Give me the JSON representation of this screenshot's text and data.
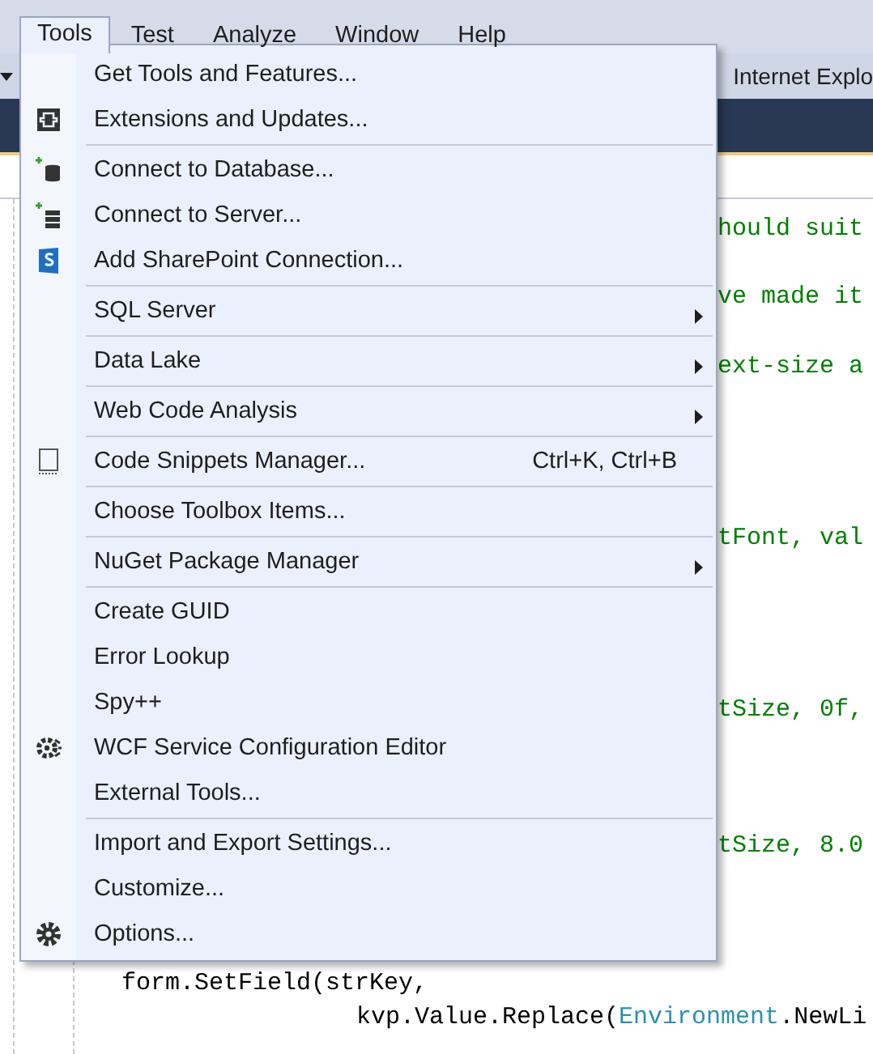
{
  "menu_bar": [
    {
      "label": "Tools",
      "selected": true
    },
    {
      "label": "Test",
      "selected": false
    },
    {
      "label": "Analyze",
      "selected": false
    },
    {
      "label": "Window",
      "selected": false
    },
    {
      "label": "Help",
      "selected": false
    }
  ],
  "toolbar": {
    "browser_button": "Internet Explo"
  },
  "editor_lines": [
    {
      "kind": "cut",
      "tokens": [
        {
          "kind": "comment",
          "text": "hould suit"
        }
      ]
    },
    {
      "kind": "blank"
    },
    {
      "kind": "cut",
      "tokens": [
        {
          "kind": "comment",
          "text": "ve made it"
        }
      ]
    },
    {
      "kind": "blank"
    },
    {
      "kind": "cut",
      "tokens": [
        {
          "kind": "comment",
          "text": "ext-size a"
        }
      ]
    },
    {
      "kind": "blank"
    },
    {
      "kind": "blank"
    },
    {
      "kind": "blank"
    },
    {
      "kind": "blank"
    },
    {
      "kind": "cut",
      "tokens": [
        {
          "kind": "comment",
          "text": "tFont, val"
        }
      ]
    },
    {
      "kind": "blank"
    },
    {
      "kind": "blank"
    },
    {
      "kind": "blank"
    },
    {
      "kind": "blank"
    },
    {
      "kind": "cut",
      "tokens": [
        {
          "kind": "comment",
          "text": "tSize, 0f,"
        }
      ]
    },
    {
      "kind": "blank"
    },
    {
      "kind": "blank"
    },
    {
      "kind": "blank"
    },
    {
      "kind": "cut",
      "tokens": [
        {
          "kind": "comment",
          "text": "tSize, 8.0"
        }
      ]
    },
    {
      "kind": "blank"
    },
    {
      "kind": "blank"
    },
    {
      "kind": "blank"
    },
    {
      "kind": "code",
      "tokens": [
        {
          "kind": "plain",
          "text": "form.SetField(strKey,"
        }
      ]
    },
    {
      "kind": "continuation",
      "tokens": [
        {
          "kind": "plain",
          "text": "kvp.Value.Replace("
        },
        {
          "kind": "type",
          "text": "Environment"
        },
        {
          "kind": "plain",
          "text": ".NewLi"
        }
      ]
    }
  ],
  "tools_menu": [
    {
      "kind": "item",
      "label": "Get Tools and Features..."
    },
    {
      "kind": "item",
      "label": "Extensions and Updates..."
    },
    {
      "kind": "separator"
    },
    {
      "kind": "item",
      "label": "Connect to Database..."
    },
    {
      "kind": "item",
      "label": "Connect to Server..."
    },
    {
      "kind": "item",
      "label": "Add SharePoint Connection..."
    },
    {
      "kind": "separator"
    },
    {
      "kind": "item",
      "label": "SQL Server",
      "submenu": true
    },
    {
      "kind": "separator"
    },
    {
      "kind": "item",
      "label": "Data Lake",
      "submenu": true
    },
    {
      "kind": "separator"
    },
    {
      "kind": "item",
      "label": "Web Code Analysis",
      "submenu": true
    },
    {
      "kind": "separator"
    },
    {
      "kind": "item",
      "label": "Code Snippets Manager...",
      "shortcut": "Ctrl+K, Ctrl+B"
    },
    {
      "kind": "separator"
    },
    {
      "kind": "item",
      "label": "Choose Toolbox Items..."
    },
    {
      "kind": "separator"
    },
    {
      "kind": "item",
      "label": "NuGet Package Manager",
      "submenu": true
    },
    {
      "kind": "separator"
    },
    {
      "kind": "item",
      "label": "Create GUID"
    },
    {
      "kind": "item",
      "label": "Error Lookup"
    },
    {
      "kind": "item",
      "label": "Spy++"
    },
    {
      "kind": "item",
      "label": "WCF Service Configuration Editor"
    },
    {
      "kind": "item",
      "label": "External Tools..."
    },
    {
      "kind": "separator"
    },
    {
      "kind": "item",
      "label": "Import and Export Settings..."
    },
    {
      "kind": "item",
      "label": "Customize..."
    },
    {
      "kind": "item",
      "label": "Options..."
    }
  ]
}
